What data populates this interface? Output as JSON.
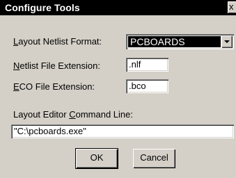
{
  "window": {
    "title": "Configure Tools",
    "close_glyph": "x"
  },
  "layout_format": {
    "label_prefix": "",
    "label_accel": "L",
    "label_rest": "ayout Netlist Format:",
    "selected": "PCBOARDS"
  },
  "netlist_ext": {
    "label_accel": "N",
    "label_rest": "etlist File Extension:",
    "value": ".nlf"
  },
  "eco_ext": {
    "label_accel": "E",
    "label_rest": "CO File Extension:",
    "value": ".bco"
  },
  "command_line": {
    "label_before": "Layout Editor ",
    "label_accel": "C",
    "label_after": "ommand Line:",
    "value": "\"C:\\pcboards.exe\""
  },
  "buttons": {
    "ok": "OK",
    "cancel": "Cancel"
  }
}
